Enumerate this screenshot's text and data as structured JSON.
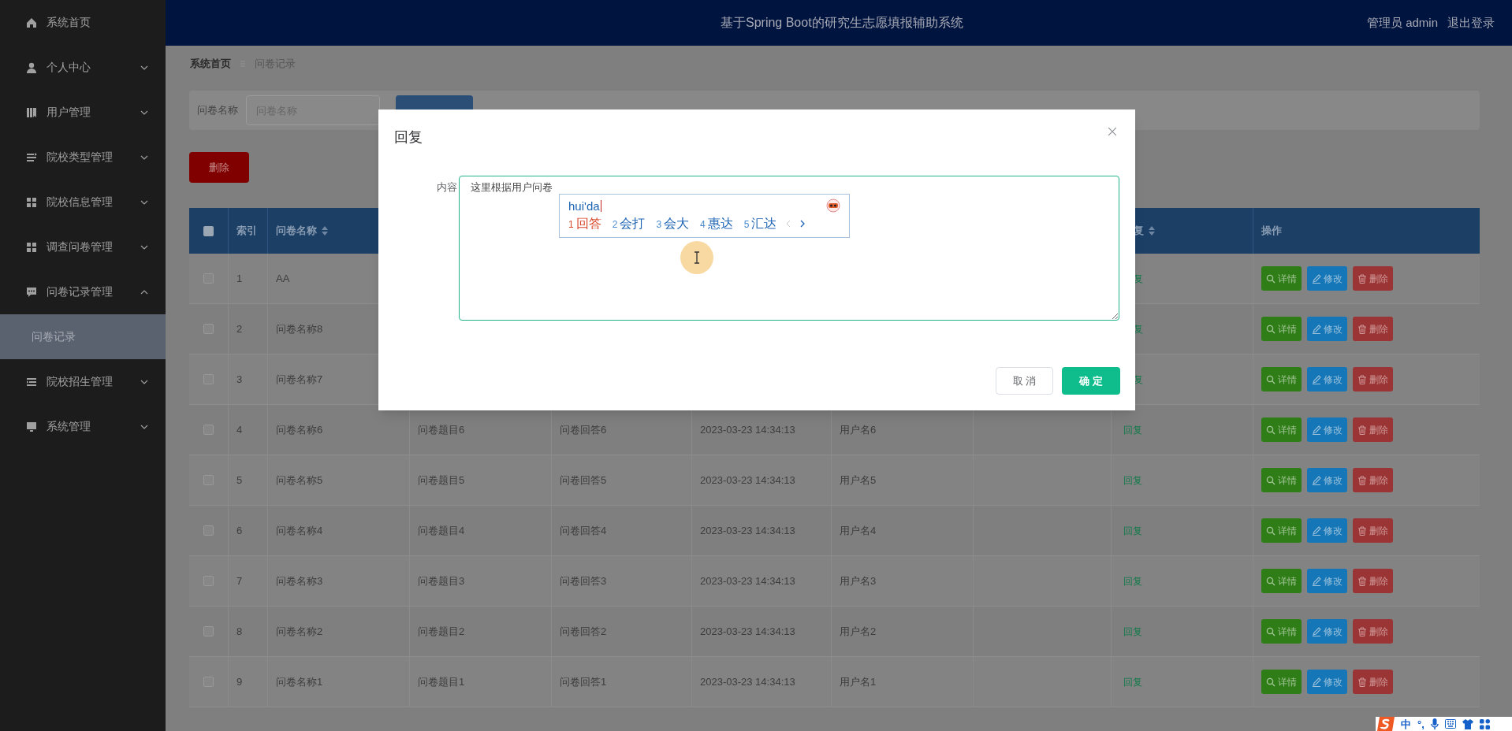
{
  "header": {
    "title": "基于Spring Boot的研究生志愿填报辅助系统",
    "user": "管理员 admin",
    "logout": "退出登录"
  },
  "sidebar": {
    "items": [
      {
        "label": "系统首页",
        "kind": "link"
      },
      {
        "label": "个人中心",
        "kind": "menu",
        "expanded": false
      },
      {
        "label": "用户管理",
        "kind": "menu",
        "expanded": false
      },
      {
        "label": "院校类型管理",
        "kind": "menu",
        "expanded": false
      },
      {
        "label": "院校信息管理",
        "kind": "menu",
        "expanded": false
      },
      {
        "label": "调查问卷管理",
        "kind": "menu",
        "expanded": false
      },
      {
        "label": "问卷记录管理",
        "kind": "menu",
        "expanded": true,
        "children": [
          {
            "label": "问卷记录",
            "selected": true
          }
        ]
      },
      {
        "label": "院校招生管理",
        "kind": "menu",
        "expanded": false
      },
      {
        "label": "系统管理",
        "kind": "menu",
        "expanded": false
      }
    ]
  },
  "breadcrumb": [
    "系统首页",
    "问卷记录"
  ],
  "search": {
    "label": "问卷名称",
    "placeholder": "问卷名称"
  },
  "delete_button": "删除",
  "table": {
    "header": {
      "checked": false,
      "index": "索引",
      "name": "问卷名称",
      "reply": "复",
      "reply_cut": true,
      "actions": "操作"
    },
    "rows": [
      {
        "checked": false,
        "index": "1",
        "name": "AA",
        "reply": "复",
        "cut": true,
        "actions": [
          "详情",
          "修改",
          "删除"
        ]
      },
      {
        "checked": false,
        "index": "2",
        "name": "问卷名称8",
        "reply": "复",
        "cut": true,
        "actions": [
          "详情",
          "修改",
          "删除"
        ]
      },
      {
        "checked": false,
        "index": "3",
        "name": "问卷名称7",
        "reply": "复",
        "cut": true,
        "actions": [
          "详情",
          "修改",
          "删除"
        ]
      },
      {
        "checked": false,
        "index": "4",
        "name": "问卷名称6",
        "question": "问卷题目6",
        "answer": "问卷回答6",
        "time": "2023-03-23 14:34:13",
        "user": "用户名6",
        "reply": "回复",
        "actions": [
          "详情",
          "修改",
          "删除"
        ]
      },
      {
        "checked": false,
        "index": "5",
        "name": "问卷名称5",
        "question": "问卷题目5",
        "answer": "问卷回答5",
        "time": "2023-03-23 14:34:13",
        "user": "用户名5",
        "reply": "回复",
        "actions": [
          "详情",
          "修改",
          "删除"
        ]
      },
      {
        "checked": false,
        "index": "6",
        "name": "问卷名称4",
        "question": "问卷题目4",
        "answer": "问卷回答4",
        "time": "2023-03-23 14:34:13",
        "user": "用户名4",
        "reply": "回复",
        "actions": [
          "详情",
          "修改",
          "删除"
        ]
      },
      {
        "checked": false,
        "index": "7",
        "name": "问卷名称3",
        "question": "问卷题目3",
        "answer": "问卷回答3",
        "time": "2023-03-23 14:34:13",
        "user": "用户名3",
        "reply": "回复",
        "actions": [
          "详情",
          "修改",
          "删除"
        ]
      },
      {
        "checked": false,
        "index": "8",
        "name": "问卷名称2",
        "question": "问卷题目2",
        "answer": "问卷回答2",
        "time": "2023-03-23 14:34:13",
        "user": "用户名2",
        "reply": "回复",
        "actions": [
          "详情",
          "修改",
          "删除"
        ]
      },
      {
        "checked": false,
        "index": "9",
        "name": "问卷名称1",
        "question": "问卷题目1",
        "answer": "问卷回答1",
        "time": "2023-03-23 14:34:13",
        "user": "用户名1",
        "reply": "回复",
        "actions": [
          "详情",
          "修改",
          "删除"
        ]
      }
    ]
  },
  "modal": {
    "title": "回复",
    "field_label": "内容",
    "value": "这里根据用户问卷",
    "ime": {
      "input": "hui'da",
      "candidates": [
        {
          "number": "1",
          "text": "回答",
          "selected": true
        },
        {
          "number": "2",
          "text": "会打",
          "selected": false
        },
        {
          "number": "3",
          "text": "会大",
          "selected": false
        },
        {
          "number": "4",
          "text": "惠达",
          "selected": false
        },
        {
          "number": "5",
          "text": "汇达",
          "selected": false
        }
      ]
    },
    "cancel": "取 消",
    "ok": "确 定"
  },
  "ime_toolbar": {
    "mode": "中",
    "punct": "°,"
  }
}
